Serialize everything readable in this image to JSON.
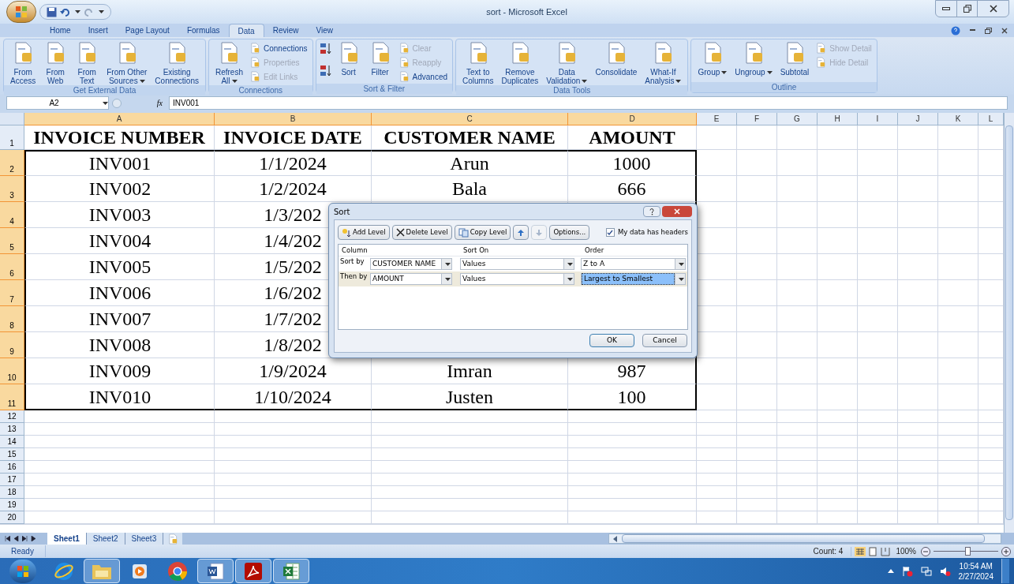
{
  "window": {
    "title": "sort - Microsoft Excel"
  },
  "ribbon": {
    "tabs": [
      {
        "label": "Home",
        "selected": false
      },
      {
        "label": "Insert",
        "selected": false
      },
      {
        "label": "Page Layout",
        "selected": false
      },
      {
        "label": "Formulas",
        "selected": false
      },
      {
        "label": "Data",
        "selected": true
      },
      {
        "label": "Review",
        "selected": false
      },
      {
        "label": "View",
        "selected": false
      }
    ],
    "groups": [
      {
        "label": "Get External Data",
        "items": [
          {
            "kind": "large",
            "label": "From\nAccess",
            "menu": false
          },
          {
            "kind": "large",
            "label": "From\nWeb",
            "menu": false
          },
          {
            "kind": "large",
            "label": "From\nText",
            "menu": false
          },
          {
            "kind": "large",
            "label": "From Other\nSources",
            "menu": true
          },
          {
            "kind": "large",
            "label": "Existing\nConnections",
            "menu": false
          }
        ]
      },
      {
        "label": "Connections",
        "items": [
          {
            "kind": "large",
            "label": "Refresh\nAll",
            "menu": true
          },
          {
            "kind": "column",
            "items": [
              {
                "label": "Connections",
                "disabled": false
              },
              {
                "label": "Properties",
                "disabled": true
              },
              {
                "label": "Edit Links",
                "disabled": true
              }
            ]
          }
        ]
      },
      {
        "label": "Sort & Filter",
        "items": [
          {
            "kind": "sorticons"
          },
          {
            "kind": "large",
            "label": "Sort",
            "menu": false
          },
          {
            "kind": "large",
            "label": "Filter",
            "menu": false
          },
          {
            "kind": "column",
            "items": [
              {
                "label": "Clear",
                "disabled": true
              },
              {
                "label": "Reapply",
                "disabled": true
              },
              {
                "label": "Advanced",
                "disabled": false
              }
            ]
          }
        ]
      },
      {
        "label": "Data Tools",
        "items": [
          {
            "kind": "large",
            "label": "Text to\nColumns",
            "menu": false
          },
          {
            "kind": "large",
            "label": "Remove\nDuplicates",
            "menu": false
          },
          {
            "kind": "large",
            "label": "Data\nValidation",
            "menu": true
          },
          {
            "kind": "large",
            "label": "Consolidate",
            "menu": false
          },
          {
            "kind": "large",
            "label": "What-If\nAnalysis",
            "menu": true
          }
        ]
      },
      {
        "label": "Outline",
        "items": [
          {
            "kind": "large",
            "label": "Group",
            "menu": true
          },
          {
            "kind": "large",
            "label": "Ungroup",
            "menu": true
          },
          {
            "kind": "large",
            "label": "Subtotal",
            "menu": false
          },
          {
            "kind": "column",
            "items": [
              {
                "label": "Show Detail",
                "disabled": true
              },
              {
                "label": "Hide Detail",
                "disabled": true
              }
            ]
          }
        ]
      }
    ]
  },
  "formula_bar": {
    "name_box": "A2",
    "function_label": "fx",
    "value": "INV001"
  },
  "sheet": {
    "columns": [
      {
        "label": "A",
        "selected": true
      },
      {
        "label": "B",
        "selected": true
      },
      {
        "label": "C",
        "selected": true
      },
      {
        "label": "D",
        "selected": true
      },
      {
        "label": "E",
        "selected": false
      },
      {
        "label": "F",
        "selected": false
      },
      {
        "label": "G",
        "selected": false
      },
      {
        "label": "H",
        "selected": false
      },
      {
        "label": "I",
        "selected": false
      },
      {
        "label": "J",
        "selected": false
      },
      {
        "label": "K",
        "selected": false
      },
      {
        "label": "L",
        "selected": false
      }
    ],
    "rows": [
      {
        "label": "1",
        "kind": "header",
        "selected": false,
        "cells": [
          "INVOICE NUMBER",
          "INVOICE DATE",
          "CUSTOMER NAME",
          "AMOUNT"
        ]
      },
      {
        "label": "2",
        "kind": "data",
        "selected": true,
        "cells": [
          "INV001",
          "1/1/2024",
          "Arun",
          "1000"
        ]
      },
      {
        "label": "3",
        "kind": "data",
        "selected": true,
        "cells": [
          "INV002",
          "1/2/2024",
          "Bala",
          "666"
        ]
      },
      {
        "label": "4",
        "kind": "data",
        "selected": true,
        "cells": [
          "INV003",
          "1/3/202"
        ]
      },
      {
        "label": "5",
        "kind": "data",
        "selected": true,
        "cells": [
          "INV004",
          "1/4/202"
        ]
      },
      {
        "label": "6",
        "kind": "data",
        "selected": true,
        "cells": [
          "INV005",
          "1/5/202"
        ]
      },
      {
        "label": "7",
        "kind": "data",
        "selected": true,
        "cells": [
          "INV006",
          "1/6/202"
        ]
      },
      {
        "label": "8",
        "kind": "data",
        "selected": true,
        "cells": [
          "INV007",
          "1/7/202"
        ]
      },
      {
        "label": "9",
        "kind": "data",
        "selected": true,
        "cells": [
          "INV008",
          "1/8/202"
        ]
      },
      {
        "label": "10",
        "kind": "data",
        "selected": true,
        "cells": [
          "INV009",
          "1/9/2024",
          "Imran",
          "987"
        ]
      },
      {
        "label": "11",
        "kind": "data",
        "selected": true,
        "cells": [
          "INV010",
          "1/10/2024",
          "Justen",
          "100"
        ]
      },
      {
        "label": "12",
        "kind": "empty",
        "selected": false,
        "cells": []
      },
      {
        "label": "13",
        "kind": "empty",
        "selected": false,
        "cells": []
      },
      {
        "label": "14",
        "kind": "empty",
        "selected": false,
        "cells": []
      },
      {
        "label": "15",
        "kind": "empty",
        "selected": false,
        "cells": []
      },
      {
        "label": "16",
        "kind": "empty",
        "selected": false,
        "cells": []
      },
      {
        "label": "17",
        "kind": "empty",
        "selected": false,
        "cells": []
      },
      {
        "label": "18",
        "kind": "empty",
        "selected": false,
        "cells": []
      },
      {
        "label": "19",
        "kind": "empty",
        "selected": false,
        "cells": []
      },
      {
        "label": "20",
        "kind": "empty",
        "selected": false,
        "cells": []
      }
    ],
    "tabs": [
      {
        "label": "Sheet1",
        "selected": true
      },
      {
        "label": "Sheet2",
        "selected": false
      },
      {
        "label": "Sheet3",
        "selected": false
      }
    ]
  },
  "dialog": {
    "title": "Sort",
    "toolbar": [
      {
        "kind": "add",
        "label": "Add Level",
        "disabled": false
      },
      {
        "kind": "delete",
        "label": "Delete Level",
        "disabled": false
      },
      {
        "kind": "copy",
        "label": "Copy Level",
        "disabled": false
      },
      {
        "kind": "up",
        "disabled": false
      },
      {
        "kind": "down",
        "disabled": true
      },
      {
        "kind": "text",
        "label": "Options...",
        "disabled": false
      }
    ],
    "headers_checkbox": {
      "label": "My data has headers",
      "checked": true
    },
    "columns": [
      "Column",
      "Sort On",
      "Order"
    ],
    "levels": [
      {
        "label": "Sort by",
        "column": "CUSTOMER NAME",
        "sort_on": "Values",
        "order": "Z to A",
        "selected": false
      },
      {
        "label": "Then by",
        "column": "AMOUNT",
        "sort_on": "Values",
        "order": "Largest to Smallest",
        "selected": true
      }
    ],
    "buttons": [
      "OK",
      "Cancel"
    ]
  },
  "status_bar": {
    "status": "Ready",
    "count": "Count: 4",
    "zoom": "100%",
    "zoom_level": {
      "level": 0.52
    }
  },
  "taskbar": {
    "items": [
      {
        "kind": "ie",
        "open": false
      },
      {
        "kind": "folder",
        "open": true
      },
      {
        "kind": "media",
        "open": false
      },
      {
        "kind": "chrome",
        "open": false
      },
      {
        "kind": "word",
        "open": true
      },
      {
        "kind": "pdf",
        "open": true
      },
      {
        "kind": "excel",
        "open": true
      }
    ],
    "time": "10:54 AM",
    "date": "2/27/2024"
  }
}
